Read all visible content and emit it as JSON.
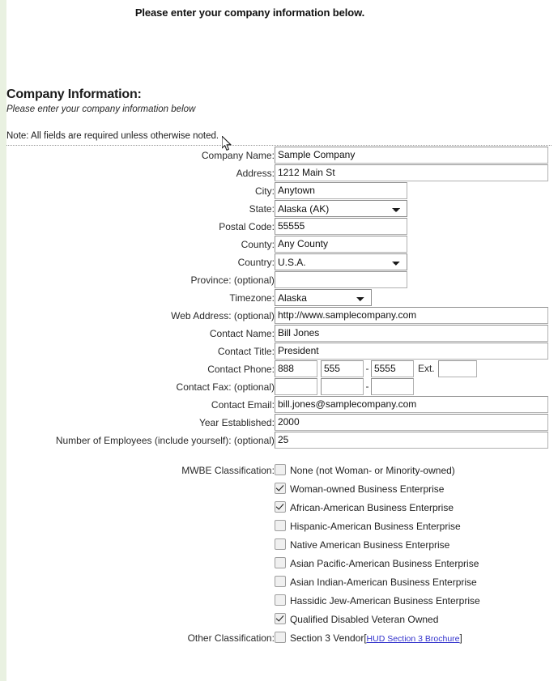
{
  "page": {
    "title": "Please enter your company information below.",
    "section_heading": "Company Information:",
    "section_subtitle": "Please enter your company information below",
    "note": "Note: All fields are required unless otherwise noted."
  },
  "fields": {
    "company_name": {
      "label": "Company Name:",
      "value": "Sample Company"
    },
    "address": {
      "label": "Address:",
      "value": "1212 Main St"
    },
    "city": {
      "label": "City:",
      "value": "Anytown"
    },
    "state": {
      "label": "State:",
      "value": "Alaska (AK)"
    },
    "postal_code": {
      "label": "Postal Code:",
      "value": "55555"
    },
    "county": {
      "label": "County:",
      "value": "Any County"
    },
    "country": {
      "label": "Country:",
      "value": "U.S.A."
    },
    "province": {
      "label": "Province: (optional)",
      "value": ""
    },
    "timezone": {
      "label": "Timezone:",
      "value": "Alaska"
    },
    "web_address": {
      "label": "Web Address: (optional)",
      "value": "http://www.samplecompany.com"
    },
    "contact_name": {
      "label": "Contact Name:",
      "value": "Bill Jones"
    },
    "contact_title": {
      "label": "Contact Title:",
      "value": "President"
    },
    "contact_phone": {
      "label": "Contact Phone:",
      "area": "888",
      "prefix": "555",
      "line": "5555",
      "separator": "-",
      "ext_label": "Ext.",
      "ext": ""
    },
    "contact_fax": {
      "label": "Contact Fax: (optional)",
      "area": "",
      "prefix": "",
      "line": "",
      "separator": "-"
    },
    "contact_email": {
      "label": "Contact Email:",
      "value": "bill.jones@samplecompany.com"
    },
    "year_established": {
      "label": "Year Established:",
      "value": "2000"
    },
    "number_of_employees": {
      "label": "Number of Employees (include yourself): (optional)",
      "value": "25"
    }
  },
  "mwbe": {
    "label": "MWBE Classification:",
    "options": [
      {
        "text": "None (not Woman- or Minority-owned)",
        "checked": false
      },
      {
        "text": "Woman-owned Business Enterprise",
        "checked": true
      },
      {
        "text": "African-American Business Enterprise",
        "checked": true
      },
      {
        "text": "Hispanic-American Business Enterprise",
        "checked": false
      },
      {
        "text": "Native American Business Enterprise",
        "checked": false
      },
      {
        "text": "Asian Pacific-American Business Enterprise",
        "checked": false
      },
      {
        "text": "Asian Indian-American Business Enterprise",
        "checked": false
      },
      {
        "text": "Hassidic Jew-American Business Enterprise",
        "checked": false
      },
      {
        "text": "Qualified Disabled Veteran Owned",
        "checked": true
      }
    ]
  },
  "other_classification": {
    "label": "Other Classification:",
    "option_text": "Section 3 Vendor",
    "link_text": "HUD Section 3 Brochure",
    "bracket_open": "[",
    "bracket_close": "]",
    "checked": false
  },
  "colors": {
    "left_strip": "#e9f1e1",
    "link": "#3333cc",
    "field_border": "#8e8e8e"
  }
}
